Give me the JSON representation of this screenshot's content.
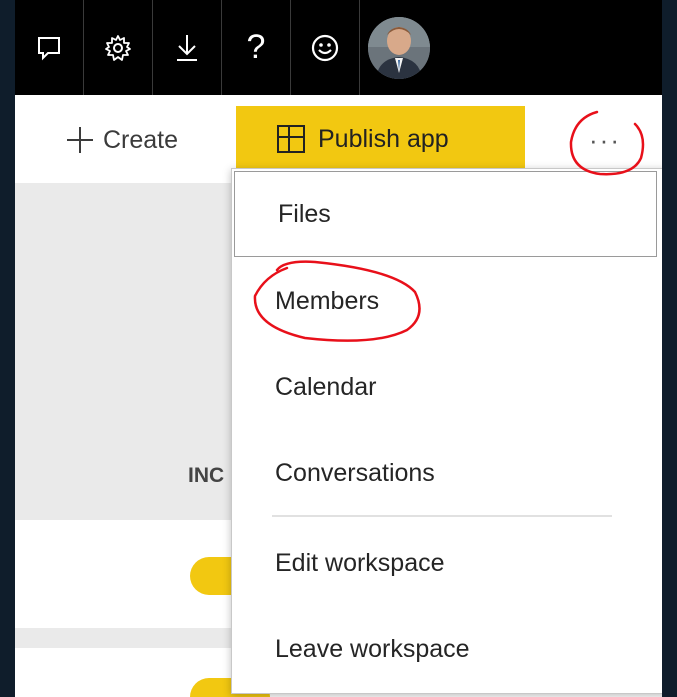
{
  "topbar": {
    "icons": [
      "feedback-icon",
      "gear-icon",
      "download-icon",
      "help-icon",
      "smiley-icon"
    ],
    "help_glyph": "?",
    "avatar": "profile-photo"
  },
  "commandbar": {
    "create_label": "Create",
    "publish_label": "Publish app",
    "more_label": "···"
  },
  "background": {
    "column_label": "INC"
  },
  "menu": {
    "items": [
      {
        "label": "Files"
      },
      {
        "label": "Members"
      },
      {
        "label": "Calendar"
      },
      {
        "label": "Conversations"
      },
      {
        "label": "Edit workspace"
      },
      {
        "label": "Leave workspace"
      }
    ]
  },
  "colors": {
    "accent": "#f2c811",
    "topbar": "#000000",
    "annotation": "#e8101a"
  }
}
